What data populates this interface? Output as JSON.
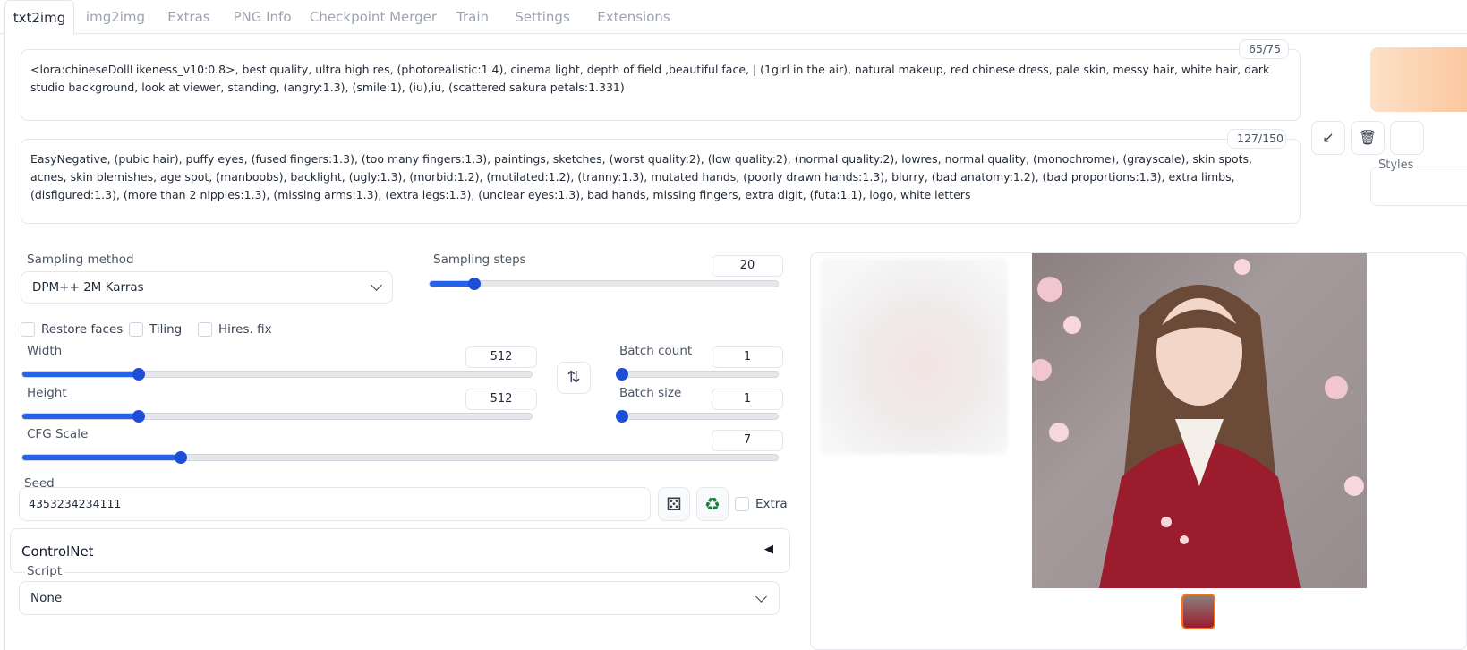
{
  "tabs": [
    "txt2img",
    "img2img",
    "Extras",
    "PNG Info",
    "Checkpoint Merger",
    "Train",
    "Settings",
    "Extensions"
  ],
  "prompt": {
    "text": "<lora:chineseDollLikeness_v10:0.8>, best quality, ultra high res, (photorealistic:1.4), cinema light, depth of field ,beautiful face, | (1girl in the air), natural makeup, red chinese dress, pale skin, messy hair, white hair, dark studio background, look at viewer, standing, (angry:1.3), (smile:1), (iu),iu, (scattered sakura petals:1.331)",
    "token_count": "65/75"
  },
  "negative_prompt": {
    "text": "EasyNegative, (pubic hair), puffy eyes, (fused fingers:1.3), (too many fingers:1.3), paintings, sketches, (worst quality:2), (low quality:2), (normal quality:2), lowres, normal quality, (monochrome), (grayscale), skin spots, acnes, skin blemishes, age spot, (manboobs), backlight, (ugly:1.3), (morbid:1.2), (mutilated:1.2), (tranny:1.3), mutated hands, (poorly drawn hands:1.3), blurry, (bad anatomy:1.2), (bad proportions:1.3), extra limbs, (disfigured:1.3), (more than 2 nipples:1.3), (missing arms:1.3), (extra legs:1.3), (unclear eyes:1.3), bad hands, missing fingers, extra digit, (futa:1.1), logo, white letters",
    "token_count": "127/150"
  },
  "tools": {
    "arrow_icon": "↙",
    "trash_icon": "🗑",
    "styles_label": "Styles"
  },
  "sampling": {
    "method_label": "Sampling method",
    "method_value": "DPM++ 2M Karras",
    "steps_label": "Sampling steps",
    "steps_value": "20",
    "steps_fraction": 0.13
  },
  "checkboxes": {
    "restore_faces": "Restore faces",
    "tiling": "Tiling",
    "hires_fix": "Hires. fix"
  },
  "width": {
    "label": "Width",
    "value": "512",
    "fraction": 0.23
  },
  "height": {
    "label": "Height",
    "value": "512",
    "fraction": 0.23
  },
  "swap_icon": "⇅",
  "batch_count": {
    "label": "Batch count",
    "value": "1",
    "fraction": 0.0
  },
  "batch_size": {
    "label": "Batch size",
    "value": "1",
    "fraction": 0.0
  },
  "cfg": {
    "label": "CFG Scale",
    "value": "7",
    "fraction": 0.21
  },
  "seed": {
    "label": "Seed",
    "value": "4353234234111",
    "dice_icon": "⚄",
    "recycle_icon": "♻",
    "extra_label": "Extra"
  },
  "controlnet": {
    "label": "ControlNet",
    "collapse_icon": "◀"
  },
  "script": {
    "label": "Script",
    "value": "None"
  },
  "colors": {
    "accent": "#2563eb",
    "generate": "#fbc59b",
    "dress": "#9b1c2c"
  }
}
